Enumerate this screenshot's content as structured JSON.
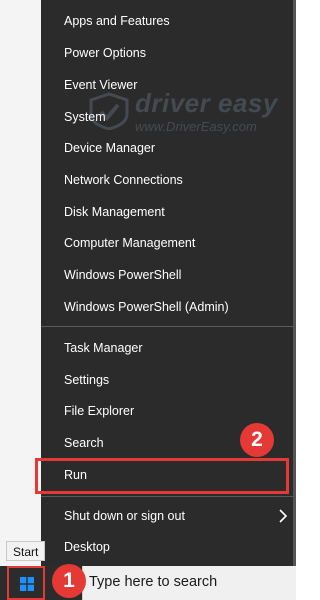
{
  "menu": {
    "items": [
      {
        "label": "Apps and Features"
      },
      {
        "label": "Power Options"
      },
      {
        "label": "Event Viewer"
      },
      {
        "label": "System"
      },
      {
        "label": "Device Manager"
      },
      {
        "label": "Network Connections"
      },
      {
        "label": "Disk Management"
      },
      {
        "label": "Computer Management"
      },
      {
        "label": "Windows PowerShell"
      },
      {
        "label": "Windows PowerShell (Admin)"
      },
      {
        "label": "Task Manager"
      },
      {
        "label": "Settings"
      },
      {
        "label": "File Explorer"
      },
      {
        "label": "Search"
      },
      {
        "label": "Run"
      },
      {
        "label": "Shut down or sign out"
      },
      {
        "label": "Desktop"
      }
    ]
  },
  "annotations": {
    "step1": "1",
    "step2": "2",
    "highlight_color": "#e53935"
  },
  "watermark": {
    "brand": "driver easy",
    "url": "www.DriverEasy.com"
  },
  "taskbar": {
    "start_tooltip": "Start",
    "search_placeholder": "Type here to search",
    "start_icon": "windows-logo-icon"
  },
  "colors": {
    "menu_background": "#2b2b2b",
    "menu_text": "#ffffff",
    "taskbar_background": "#2c2c2c",
    "accent_blue": "#0a84ff"
  }
}
